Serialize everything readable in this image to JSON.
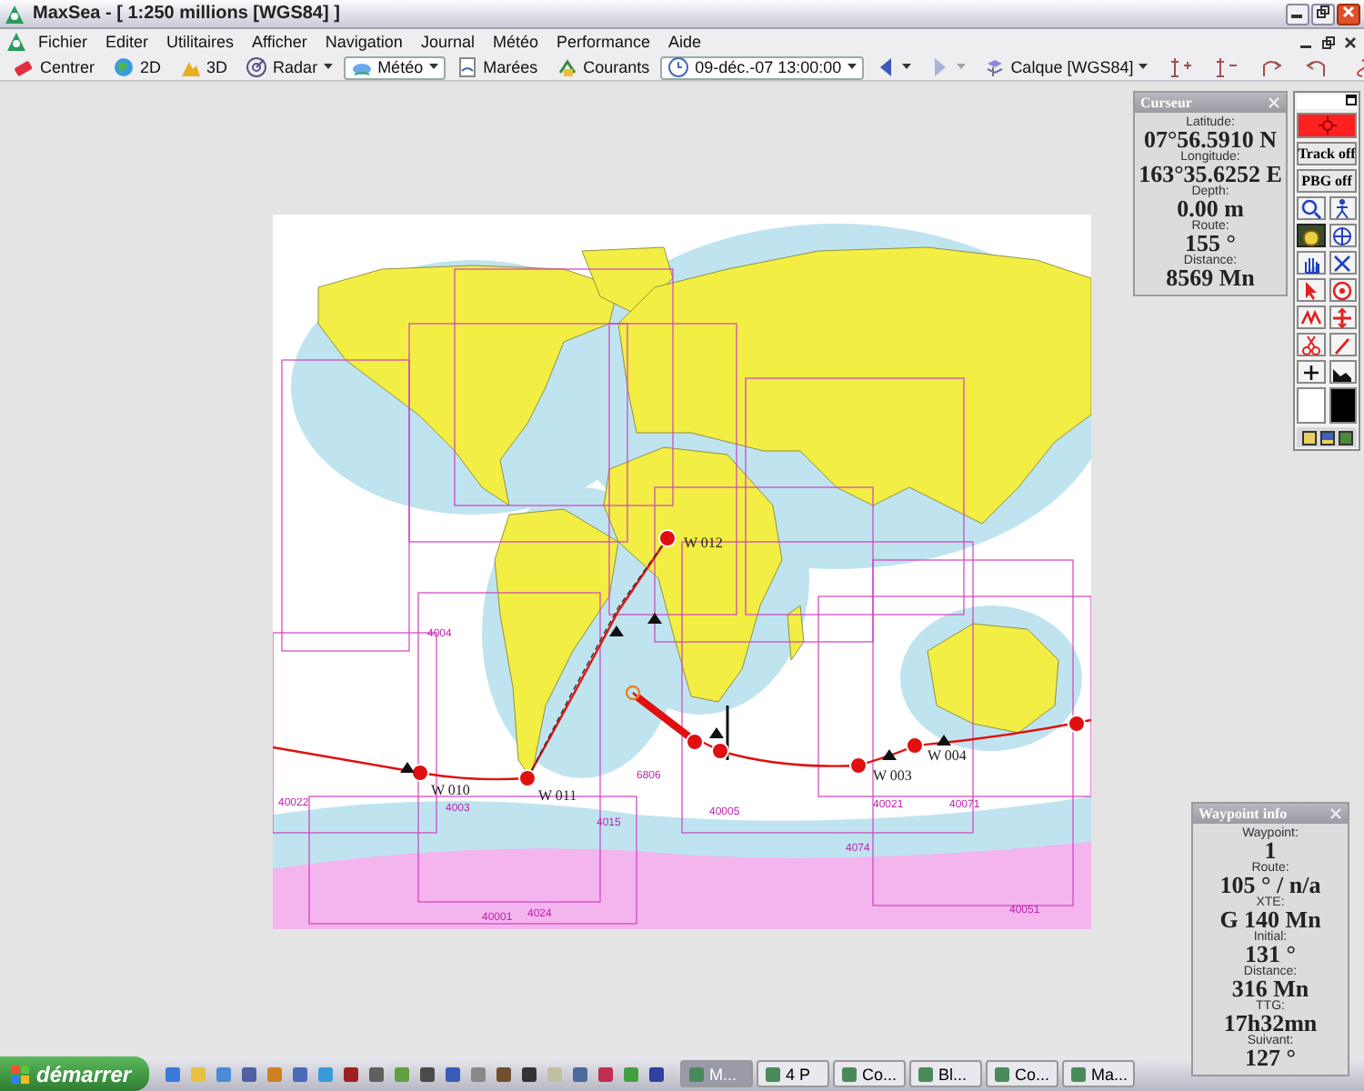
{
  "window": {
    "title": "MaxSea - [ 1:250 millions [WGS84] ]"
  },
  "menu": [
    "Fichier",
    "Editer",
    "Utilitaires",
    "Afficher",
    "Navigation",
    "Journal",
    "Météo",
    "Performance",
    "Aide"
  ],
  "toolbar": [
    {
      "kind": "eraser",
      "label": "Centrer",
      "dropdown": false,
      "disabled": false
    },
    {
      "kind": "globe",
      "label": "2D",
      "dropdown": false,
      "disabled": false
    },
    {
      "kind": "mountain",
      "label": "3D",
      "dropdown": false,
      "disabled": false
    },
    {
      "kind": "radar",
      "label": "Radar",
      "dropdown": true,
      "disabled": false
    },
    {
      "kind": "weather",
      "label": "Météo",
      "dropdown": true,
      "disabled": false
    },
    {
      "kind": "tide",
      "label": "Marées",
      "dropdown": false,
      "disabled": false
    },
    {
      "kind": "current",
      "label": "Courants",
      "dropdown": false,
      "disabled": false
    },
    {
      "kind": "clock",
      "label": "09-déc.-07 13:00:00",
      "dropdown": true,
      "disabled": false
    },
    {
      "kind": "back",
      "dropdown": true,
      "disabled": false
    },
    {
      "kind": "forward",
      "dropdown": true,
      "disabled": true
    },
    {
      "kind": "layer",
      "label": "Calque [WGS84]",
      "dropdown": true,
      "disabled": false
    }
  ],
  "map": {
    "waypoints": [
      "W 012",
      "W 011",
      "W 010",
      "W 003",
      "W 004"
    ],
    "chart_numbers": [
      "4004",
      "40022",
      "4003",
      "40001",
      "4015",
      "4024",
      "40021",
      "40071",
      "4074",
      "40051",
      "6806",
      "40005"
    ]
  },
  "cursor_panel": {
    "title": "Curseur",
    "fields": [
      {
        "label": "Latitude:",
        "value": "07°56.5910 N"
      },
      {
        "label": "Longitude:",
        "value": "163°35.6252 E"
      },
      {
        "label": "Depth:",
        "value": "0.00 m"
      },
      {
        "label": "Route:",
        "value": "155 °"
      },
      {
        "label": "Distance:",
        "value": "8569 Mn"
      }
    ]
  },
  "toolbox": {
    "track": "Track off",
    "pbg": "PBG off",
    "tools": [
      {
        "kind": "zoom",
        "selected": false
      },
      {
        "kind": "person",
        "selected": false
      },
      {
        "kind": "pan",
        "selected": true
      },
      {
        "kind": "center",
        "selected": false
      },
      {
        "kind": "grab",
        "selected": false
      },
      {
        "kind": "scatter",
        "selected": false
      },
      {
        "kind": "select",
        "selected": false
      },
      {
        "kind": "circle",
        "selected": false
      },
      {
        "kind": "erase",
        "selected": false
      },
      {
        "kind": "move",
        "selected": false
      },
      {
        "kind": "cut",
        "selected": false
      },
      {
        "kind": "pencil",
        "selected": false
      },
      {
        "kind": "plus",
        "selected": false
      },
      {
        "kind": "profile",
        "selected": false
      }
    ],
    "swatches": [
      {
        "color": "#ffffff"
      },
      {
        "color": "#000000"
      }
    ]
  },
  "waypoint_panel": {
    "title": "Waypoint info",
    "fields": [
      {
        "label": "Waypoint:",
        "value": "1"
      },
      {
        "label": "Route:",
        "value": "105 ° / n/a"
      },
      {
        "label": "XTE:",
        "value": "G 140 Mn"
      },
      {
        "label": "Initial:",
        "value": "131 °"
      },
      {
        "label": "Distance:",
        "value": "316 Mn"
      },
      {
        "label": "TTG:",
        "value": "17h32mn"
      },
      {
        "label": "Suivant:",
        "value": "127 °"
      }
    ]
  },
  "taskbar": {
    "start": "démarrer",
    "tasks": [
      {
        "label": "M...",
        "selected": true
      },
      {
        "label": "4 P",
        "selected": false
      },
      {
        "label": "Co...",
        "selected": false
      },
      {
        "label": "Bl...",
        "selected": false
      },
      {
        "label": "Co...",
        "selected": false
      },
      {
        "label": "Ma...",
        "selected": false
      }
    ]
  }
}
